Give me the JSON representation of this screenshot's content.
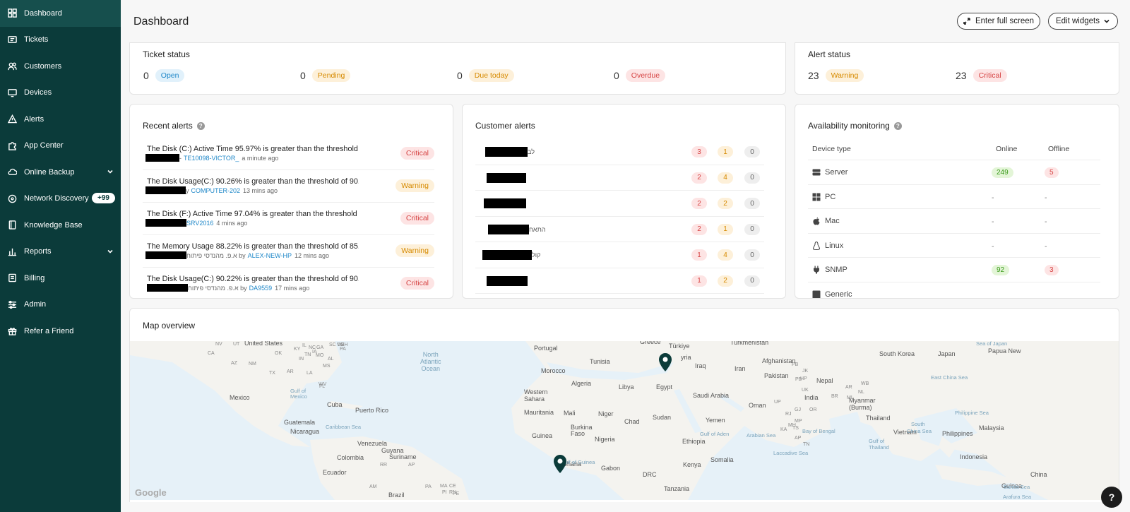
{
  "sidebar": {
    "items": [
      {
        "label": "Dashboard",
        "icon": "grid-icon",
        "active": true
      },
      {
        "label": "Tickets",
        "icon": "ticket-icon"
      },
      {
        "label": "Customers",
        "icon": "users-icon"
      },
      {
        "label": "Devices",
        "icon": "monitor-icon"
      },
      {
        "label": "Alerts",
        "icon": "warning-triangle-icon"
      },
      {
        "label": "App Center",
        "icon": "puzzle-icon"
      },
      {
        "label": "Online Backup",
        "icon": "cloud-icon",
        "has_chevron": true
      },
      {
        "label": "Network Discovery",
        "icon": "network-icon",
        "badge": "+99"
      },
      {
        "label": "Knowledge Base",
        "icon": "book-icon"
      },
      {
        "label": "Reports",
        "icon": "bar-chart-icon",
        "has_chevron": true
      },
      {
        "label": "Billing",
        "icon": "billing-icon"
      },
      {
        "label": "Admin",
        "icon": "sliders-icon"
      },
      {
        "label": "Refer a Friend",
        "icon": "gift-icon"
      }
    ]
  },
  "header": {
    "title": "Dashboard",
    "fullscreen_label": "Enter full screen",
    "edit_widgets_label": "Edit widgets"
  },
  "ticket_status": {
    "title": "Ticket status",
    "items": [
      {
        "count": "0",
        "label": "Open",
        "color": "blue"
      },
      {
        "count": "0",
        "label": "Pending",
        "color": "yellow"
      },
      {
        "count": "0",
        "label": "Due today",
        "color": "yellow"
      },
      {
        "count": "0",
        "label": "Overdue",
        "color": "red"
      }
    ]
  },
  "alert_status": {
    "title": "Alert status",
    "items": [
      {
        "count": "23",
        "label": "Warning",
        "color": "yellow"
      },
      {
        "count": "23",
        "label": "Critical",
        "color": "red"
      }
    ]
  },
  "recent_alerts": {
    "title": "Recent alerts",
    "rows": [
      {
        "text": "The Disk (C:) Active Time 95.97% is greater than the threshold ...",
        "prefix": "-",
        "device": "TE10098-VICTOR_",
        "time": "a minute ago",
        "severity": "Critical"
      },
      {
        "text": "The Disk Usage(C:) 90.26% is greater than the threshold of 90....",
        "prefix": "y",
        "device": "COMPUTER-202",
        "time": "13 mins ago",
        "severity": "Warning"
      },
      {
        "text": "The Disk (F:) Active Time 97.04% is greater than the threshold ...",
        "prefix": "",
        "device": "SRV2016",
        "time": "4 mins ago",
        "severity": "Critical"
      },
      {
        "text": "The Memory Usage 88.22% is greater than the threshold of 85....",
        "prefix": "א.פ. מהנדסי פיתוח by",
        "device": "ALEX-NEW-HP",
        "time": "12 mins ago",
        "severity": "Warning"
      },
      {
        "text": "The Disk Usage(C:) 90.22% is greater than the threshold of 90....",
        "prefix": "א.פ. מהנדסי פיתוח by",
        "device": "DA9559",
        "time": "17 mins ago",
        "severity": "Critical"
      }
    ]
  },
  "customer_alerts": {
    "title": "Customer alerts",
    "rows": [
      {
        "name_suffix": "לב",
        "critical": "3",
        "warning": "1",
        "other": "0"
      },
      {
        "name_suffix": "",
        "critical": "2",
        "warning": "4",
        "other": "0"
      },
      {
        "name_suffix": "",
        "critical": "2",
        "warning": "2",
        "other": "0"
      },
      {
        "name_suffix": "התאח",
        "critical": "2",
        "warning": "1",
        "other": "0"
      },
      {
        "name_suffix": "קול",
        "critical": "1",
        "warning": "4",
        "other": "0"
      },
      {
        "name_suffix": "",
        "critical": "1",
        "warning": "2",
        "other": "0"
      }
    ]
  },
  "availability": {
    "title": "Availability monitoring",
    "col_device_type": "Device type",
    "col_online": "Online",
    "col_offline": "Offline",
    "rows": [
      {
        "type": "Server",
        "icon": "server-icon",
        "online": "249",
        "offline": "5"
      },
      {
        "type": "PC",
        "icon": "windows-icon",
        "online": "-",
        "offline": "-"
      },
      {
        "type": "Mac",
        "icon": "apple-icon",
        "online": "-",
        "offline": "-"
      },
      {
        "type": "Linux",
        "icon": "linux-icon",
        "online": "-",
        "offline": "-"
      },
      {
        "type": "SNMP",
        "icon": "plug-icon",
        "online": "92",
        "offline": "3"
      },
      {
        "type": "Generic",
        "icon": "generic-icon",
        "online": "",
        "offline": ""
      }
    ]
  },
  "map": {
    "title": "Map overview",
    "google": "Google",
    "labels": [
      {
        "t": "United States",
        "c": ""
      },
      {
        "t": "Mexico",
        "c": ""
      },
      {
        "t": "Cuba",
        "c": ""
      },
      {
        "t": "Puerto Rico",
        "c": ""
      },
      {
        "t": "Guatemala",
        "c": ""
      },
      {
        "t": "Nicaragua",
        "c": ""
      },
      {
        "t": "Venezuela",
        "c": ""
      },
      {
        "t": "Guyana",
        "c": ""
      },
      {
        "t": "Suriname",
        "c": ""
      },
      {
        "t": "Colombia",
        "c": ""
      },
      {
        "t": "Ecuador",
        "c": ""
      },
      {
        "t": "Brazil",
        "c": ""
      },
      {
        "t": "Portugal",
        "c": ""
      },
      {
        "t": "Morocco",
        "c": ""
      },
      {
        "t": "Tunisia",
        "c": ""
      },
      {
        "t": "Algeria",
        "c": ""
      },
      {
        "t": "Libya",
        "c": ""
      },
      {
        "t": "Egypt",
        "c": ""
      },
      {
        "t": "Western",
        "c": ""
      },
      {
        "t": "Sahara",
        "c": ""
      },
      {
        "t": "Mauritania",
        "c": ""
      },
      {
        "t": "Mali",
        "c": ""
      },
      {
        "t": "Niger",
        "c": ""
      },
      {
        "t": "Chad",
        "c": ""
      },
      {
        "t": "Sudan",
        "c": ""
      },
      {
        "t": "Burkina",
        "c": ""
      },
      {
        "t": "Faso",
        "c": ""
      },
      {
        "t": "Guinea",
        "c": ""
      },
      {
        "t": "Nigeria",
        "c": ""
      },
      {
        "t": "Ghana",
        "c": ""
      },
      {
        "t": "Gabon",
        "c": ""
      },
      {
        "t": "DRC",
        "c": ""
      },
      {
        "t": "Tanzania",
        "c": ""
      },
      {
        "t": "Kenya",
        "c": ""
      },
      {
        "t": "Ethiopia",
        "c": ""
      },
      {
        "t": "Somalia",
        "c": ""
      },
      {
        "t": "Yemen",
        "c": ""
      },
      {
        "t": "Oman",
        "c": ""
      },
      {
        "t": "Saudi Arabia",
        "c": ""
      },
      {
        "t": "Greece",
        "c": ""
      },
      {
        "t": "Türkiye",
        "c": ""
      },
      {
        "t": "yria",
        "c": ""
      },
      {
        "t": "Iraq",
        "c": ""
      },
      {
        "t": "Iran",
        "c": ""
      },
      {
        "t": "Turkmenistan",
        "c": ""
      },
      {
        "t": "Afghanistan",
        "c": ""
      },
      {
        "t": "Pakistan",
        "c": ""
      },
      {
        "t": "Nepal",
        "c": ""
      },
      {
        "t": "India",
        "c": ""
      },
      {
        "t": "Myanmar",
        "c": ""
      },
      {
        "t": "(Burma)",
        "c": ""
      },
      {
        "t": "Thailand",
        "c": ""
      },
      {
        "t": "Vietnam",
        "c": ""
      },
      {
        "t": "Philippines",
        "c": ""
      },
      {
        "t": "Malaysia",
        "c": ""
      },
      {
        "t": "Indonesia",
        "c": ""
      },
      {
        "t": "China",
        "c": ""
      },
      {
        "t": "South Korea",
        "c": ""
      },
      {
        "t": "Japan",
        "c": ""
      },
      {
        "t": "Papua New",
        "c": ""
      },
      {
        "t": "Guinea",
        "c": ""
      }
    ],
    "small_labels": [
      "NV",
      "UT",
      "CA",
      "AZ",
      "NM",
      "TX",
      "OK",
      "AR",
      "LA",
      "MS",
      "AL",
      "GA",
      "SC",
      "NC",
      "VA",
      "WV",
      "KY",
      "TN",
      "MO",
      "IA",
      "IL",
      "IN",
      "OH",
      "PA",
      "DE",
      "FL",
      "RR",
      "AP",
      "AM",
      "PA",
      "MA",
      "CE",
      "RN",
      "PI",
      "PE",
      "PB",
      "JK",
      "HP",
      "PB",
      "UK",
      "UP",
      "RJ",
      "GJ",
      "MP",
      "MH",
      "TS",
      "KA",
      "AP",
      "TN",
      "OR",
      "BR",
      "ML",
      "AR",
      "NL",
      "WB"
    ],
    "sea_labels": [
      "Gulf of",
      "Mexico",
      "Caribbean Sea",
      "Gulf of Guinea",
      "Gulf of Aden",
      "Arabian Sea",
      "Laccadive Sea",
      "Bay of Bengal",
      "Gulf of",
      "Thailand",
      "South",
      "China Sea",
      "East China Sea",
      "Philippine Sea",
      "Sea of Japan",
      "Banda Sea",
      "Arafura Sea"
    ],
    "ocean_labels": [
      "North",
      "Atlantic",
      "Ocean"
    ]
  },
  "help_button": "?"
}
